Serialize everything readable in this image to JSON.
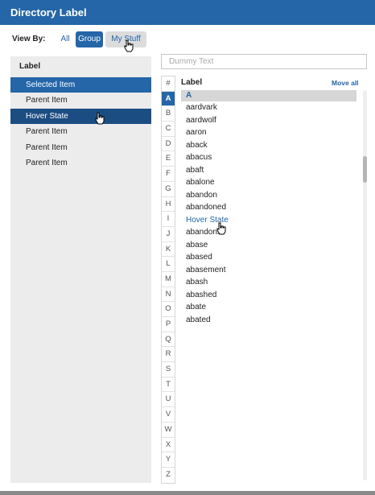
{
  "header": {
    "title": "Directory Label"
  },
  "viewby": {
    "label": "View By:",
    "options": [
      "All",
      "Group",
      "My Stuff"
    ]
  },
  "left": {
    "label": "Label",
    "items": [
      "Selected Item",
      "Parent Item",
      "Hover State",
      "Parent Item",
      "Parent Item",
      "Parent Item"
    ]
  },
  "search": {
    "placeholder": "Dummy Text"
  },
  "alphabet": [
    "#",
    "A",
    "B",
    "C",
    "D",
    "E",
    "F",
    "G",
    "H",
    "I",
    "J",
    "K",
    "L",
    "M",
    "N",
    "O",
    "P",
    "Q",
    "R",
    "S",
    "T",
    "U",
    "V",
    "W",
    "X",
    "Y",
    "Z"
  ],
  "list": {
    "label": "Label",
    "move_all": "Move all",
    "letter_header": "A",
    "words": [
      "aardvark",
      "aardwolf",
      "aaron",
      "aback",
      "abacus",
      "abaft",
      "abalone",
      "abandon",
      "abandoned",
      "Hover State",
      "abandons",
      "abase",
      "abased",
      "abasement",
      "abash",
      "abashed",
      "abate",
      "abated"
    ]
  }
}
